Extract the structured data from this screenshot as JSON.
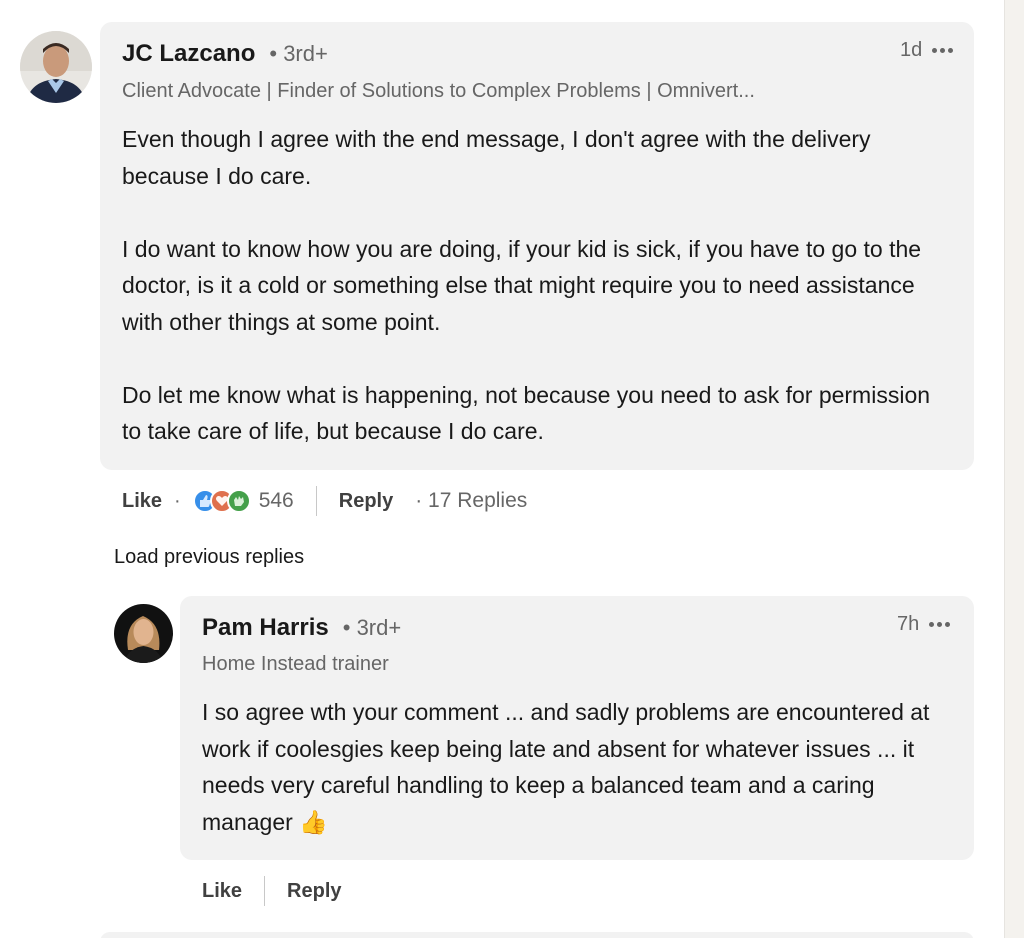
{
  "comments": [
    {
      "author": "JC Lazcano",
      "degree": "• 3rd+",
      "headline": "Client Advocate | Finder of Solutions to Complex Problems | Omnivert...",
      "time": "1d",
      "paragraphs": [
        "Even though I agree with the end message, I don't agree with the delivery because I do care.",
        "I do want to know how you are doing, if your kid is sick, if you have to go to the doctor, is it a cold or something else that might require you to need assistance with other things at some point.",
        "Do let me know what is happening, not because you need to ask for permission to take care of life, but because I do care."
      ],
      "actions": {
        "like": "Like",
        "dot": "·",
        "reaction_icons": [
          "like-icon",
          "love-icon",
          "celebrate-icon"
        ],
        "reaction_count": "546",
        "reply": "Reply",
        "replies_count": "· 17 Replies"
      }
    }
  ],
  "load_previous": "Load previous replies",
  "replies": [
    {
      "author": "Pam Harris",
      "degree": "• 3rd+",
      "headline": "Home Instead trainer",
      "time": "7h",
      "text": "I so agree wth your comment ... and sadly problems are encountered at work if coolesgies keep being late and absent for whatever issues ... it needs very careful handling to keep a balanced team and a caring manager",
      "emoji": "👍",
      "actions": {
        "like": "Like",
        "reply": "Reply"
      }
    }
  ],
  "colors": {
    "bubble": "#f2f2f2",
    "like_blue": "#378fe9",
    "love_red": "#df704d",
    "celebrate_green": "#44a04a"
  }
}
